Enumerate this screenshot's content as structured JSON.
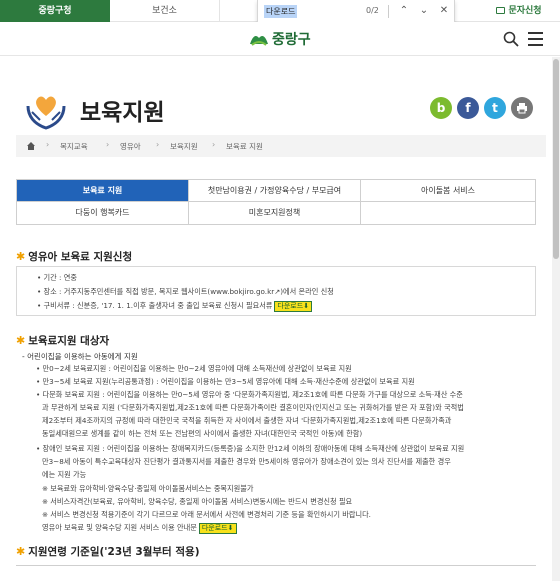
{
  "topbar": {
    "tab1": "중랑구청",
    "tab2": "보건소",
    "sms": "문자신청"
  },
  "findbar": {
    "query": "다운로드",
    "count": "0/2"
  },
  "header": {
    "logo_text": "중랑구"
  },
  "page": {
    "title": "보육지원",
    "breadcrumb": [
      "복지교육",
      "영유아",
      "보육지원",
      "보육료 지원"
    ]
  },
  "share": [
    "b",
    "f",
    "t",
    "print-icon"
  ],
  "tabs": {
    "row1": [
      "보육료 지원",
      "첫만남이용권 / 가정양육수당 / 부모급여",
      "아이돌봄 서비스"
    ],
    "row2": [
      "다둥이 행복카드",
      "미혼모지원정책"
    ]
  },
  "section1": {
    "title": "영유아 보육료 지원신청",
    "items": [
      "기간 : 연중",
      "장소 : 거주지동주민센터를 직접 방문, 복지로 웹사이트(www.bokjiro.go.kr",
      "구비서류 : 신분증, '17. 1. 1.이후 출생자녀 중 출입 보육료 신청시 필요서류"
    ],
    "item2_suffix": ")에서 온라인 신청",
    "download": "다운로드"
  },
  "section2": {
    "title": "보육료지원 대상자",
    "intro": "- 어린이집을 이용하는 아동에게 지원",
    "lines": [
      "만0~2세 보육료지원 : 어린이집을 이용하는 만0~2세 영유아에 대해 소득재산에 상관없이 보육료 지원",
      "만3~5세 보육료 지원(누리공통과정) : 어린이집을 이용하는 만3~5세 영유아에 대해 소득·재산수준에 상관없이 보육료 지원",
      "다문화 보육료 지원 : 어린이집을 이용하는 만0~5세 영유아 중 '다문화가족지원법, 제2조1호에 따른 다문화 가구를 대상으로 소득·재산 수준",
      "과 무관하게 보육료 지원 ('다문화가족지원법,제2조1호에 따른 다문화가족이란 결혼이민자(인지신고 또는 귀화허가를 받은 자 포함)와 국적법",
      "제2조부터 제4조까지의 규정에 따라 대한민국 국적을 취득한 자 사이에서 출생한 자녀 '다문화가족지원법,제2조1호에 따른 다문화가족과",
      "동일세대원으로 생계를 같이 하는 전처 또는 전남편의 사이에서 출생한 자녀(대한민국 국적인 아동)에 한함)",
      "장애인 보육료 지원 : 어린이집을 이용하는 장애복지카드(등록증)을 소지한 만12세 이하의 장애아동에 대해 소득재산에 상관없이 보육료 지원",
      "만3~8세 아동이 특수교육대상자 진단평가 결과통지서를 제출한 경우와 만5세이하 영유아가 장애소견이 있는 의사 진단서를 제출한 경우",
      "에는 지원 가능",
      "※ 보육료와 유아학비·양육수당·종일제 아이돌봄서비스는 중복지원불가",
      "※ 서비스자격간(보육료, 유아학비, 양육수당, 종일제 아이돌봄 서비스)변동시에는 반드시 변경신청 필요",
      "※ 서비스 변경신청 적용기준이 각기 다르므로 아래 문서에서 사전에 변경처리 기준 등을 확인하시기 바랍니다.",
      "영유아 보육료 및 양육수당 지원 서비스 이용 안내문"
    ],
    "download": "다운로드"
  },
  "section3": {
    "title": "지원연령 기준일('23년 3월부터 적용)"
  }
}
